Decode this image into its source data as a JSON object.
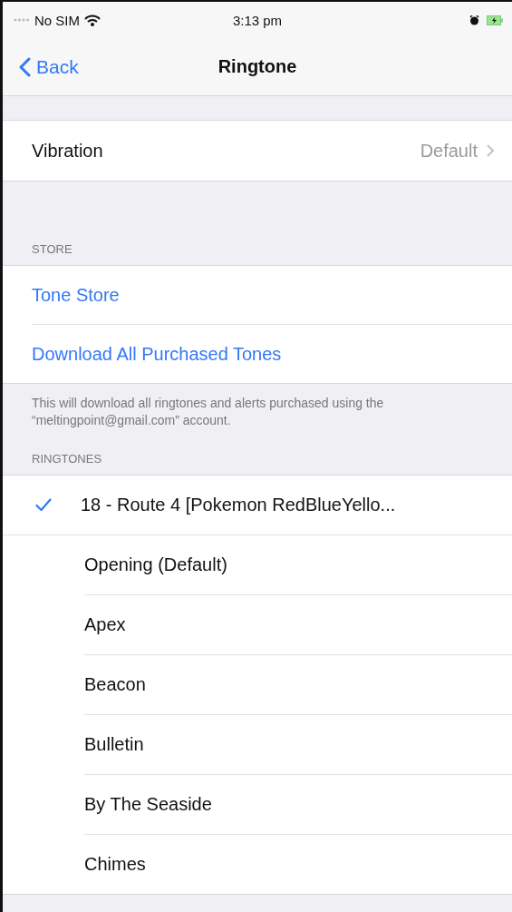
{
  "status_bar": {
    "carrier": "No SIM",
    "time": "3:13 pm"
  },
  "nav": {
    "back": "Back",
    "title": "Ringtone"
  },
  "vibration": {
    "label": "Vibration",
    "value": "Default"
  },
  "store": {
    "header": "STORE",
    "items": [
      {
        "label": "Tone Store"
      },
      {
        "label": "Download All Purchased Tones"
      }
    ],
    "footer": "This will download all ringtones and alerts purchased using the “meltingpoint@gmail.com” account."
  },
  "ringtones": {
    "header": "RINGTONES",
    "items": [
      {
        "label": "18 - Route 4 [Pokemon RedBlueYello...",
        "selected": true
      },
      {
        "label": "Opening (Default)",
        "selected": false
      },
      {
        "label": "Apex",
        "selected": false
      },
      {
        "label": "Beacon",
        "selected": false
      },
      {
        "label": "Bulletin",
        "selected": false
      },
      {
        "label": "By The Seaside",
        "selected": false
      },
      {
        "label": "Chimes",
        "selected": false
      }
    ]
  }
}
